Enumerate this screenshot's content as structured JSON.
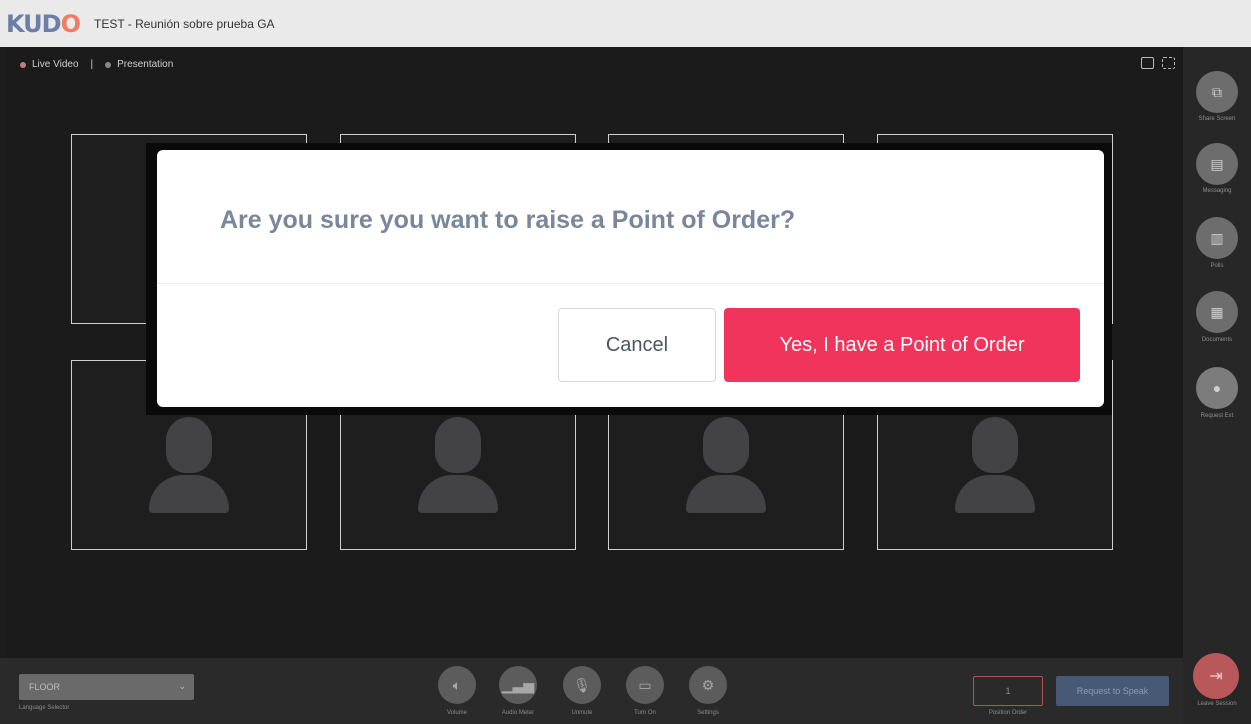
{
  "header": {
    "logo_text": "KUDO",
    "meeting_title": "TEST - Reunión sobre prueba GA",
    "right_text_a": "",
    "right_text_b": ""
  },
  "stage": {
    "view_tabs": [
      {
        "label": "Live Video",
        "active": true
      },
      {
        "label": "Presentation",
        "active": false
      }
    ],
    "tile_count": 8
  },
  "sidebar": {
    "items": [
      {
        "label": "Share Screen",
        "icon": "share-screen-icon"
      },
      {
        "label": "Messaging",
        "icon": "chat-icon"
      },
      {
        "label": "Polls",
        "icon": "polls-icon"
      },
      {
        "label": "Documents",
        "icon": "document-icon"
      },
      {
        "label": "Request Ext",
        "icon": "request-icon"
      }
    ],
    "leave_label": "Leave Session"
  },
  "bottombar": {
    "language_value": "FLOOR",
    "language_label": "Language Selector",
    "controls": [
      {
        "label": "Volume",
        "icon": "speaker-icon"
      },
      {
        "label": "Audio Meter",
        "icon": "audio-meter-icon"
      },
      {
        "label": "Unmute",
        "icon": "microphone-icon"
      },
      {
        "label": "Turn On",
        "icon": "camera-icon"
      },
      {
        "label": "Settings",
        "icon": "gear-icon"
      }
    ],
    "queue_value": "1",
    "queue_label": "Position Order",
    "request_label": "Request to Speak"
  },
  "modal": {
    "title": "Are you sure you want to raise a Point of Order?",
    "cancel_label": "Cancel",
    "confirm_label": "Yes, I have a Point of Order"
  },
  "colors": {
    "accent": "#f1345b",
    "title_gray": "#7a8699",
    "background": "#1b1b1c"
  }
}
